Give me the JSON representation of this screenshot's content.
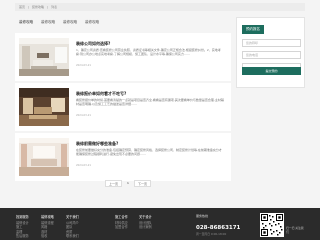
{
  "breadcrumb": {
    "items": [
      "首页",
      "装修攻略",
      "列表"
    ]
  },
  "tabs": [
    "装修攻略",
    "装修攻略",
    "装修攻略",
    "装修攻略"
  ],
  "articles": [
    {
      "title": "装修公司如何选择?",
      "body": "1、确定公司资质:查看装修公司营业执照、资质证书等相关文件,确定公司正规合法,规避装修纠纷。2、实地考察:到公司办公地点实地考察,了解公司规模、施工团队、设计水平等,确保公司实力……",
      "date": "2024-03-21"
    },
    {
      "title": "装修报价单如何看才不吃亏?",
      "body": "看装修报价单的时候,首要看清楚的一点就是项目是否齐全,看看是否有漏项,其次要看单价与数量是否合理,主材辅材是否明确,以及施工工艺的描述是否详细……",
      "date": "2024-03-21"
    },
    {
      "title": "装修前需做好哪些准备?",
      "body": "在装修前要做好充分的准备,包括确定预算、确定装修风格、选择装修公司、制定装修计划等,在前期准备充分才能确保装修过程顺利进行,避免出现不必要的问题……",
      "date": "2024-03-21"
    }
  ],
  "sidebar": {
    "heading": "预约报名",
    "name_placeholder": "您的称呼",
    "phone_placeholder": "您的电话",
    "submit_label": "提交预约"
  },
  "pager": {
    "prev": "上一页",
    "current": "1",
    "next": "下一页"
  },
  "footer": {
    "cols": [
      {
        "heading": "找到服务",
        "items": [
          "装修设计",
          "施工",
          "监理",
          "售后服务"
        ]
      },
      {
        "heading": "装修攻略",
        "items": [
          "装修流程",
          "风格",
          "选材",
          "验收"
        ]
      },
      {
        "heading": "关于我们",
        "items": [
          "公司简介",
          "团队",
          "资质",
          "联系我们"
        ]
      },
      {
        "heading": "施工合作",
        "items": [
          "材料供应",
          "加盟合作"
        ]
      },
      {
        "heading": "关于设计",
        "items": [
          "设计团队",
          "设计案例"
        ]
      }
    ],
    "contact_label": "服务热线",
    "phone": "028-86863171",
    "hours": "周一至周日 9:00-18:00",
    "qr_caption": "扫一扫 关注我们"
  },
  "colors": {
    "accent": "#1d6d5e",
    "footer_bg": "#2b2b2b"
  }
}
